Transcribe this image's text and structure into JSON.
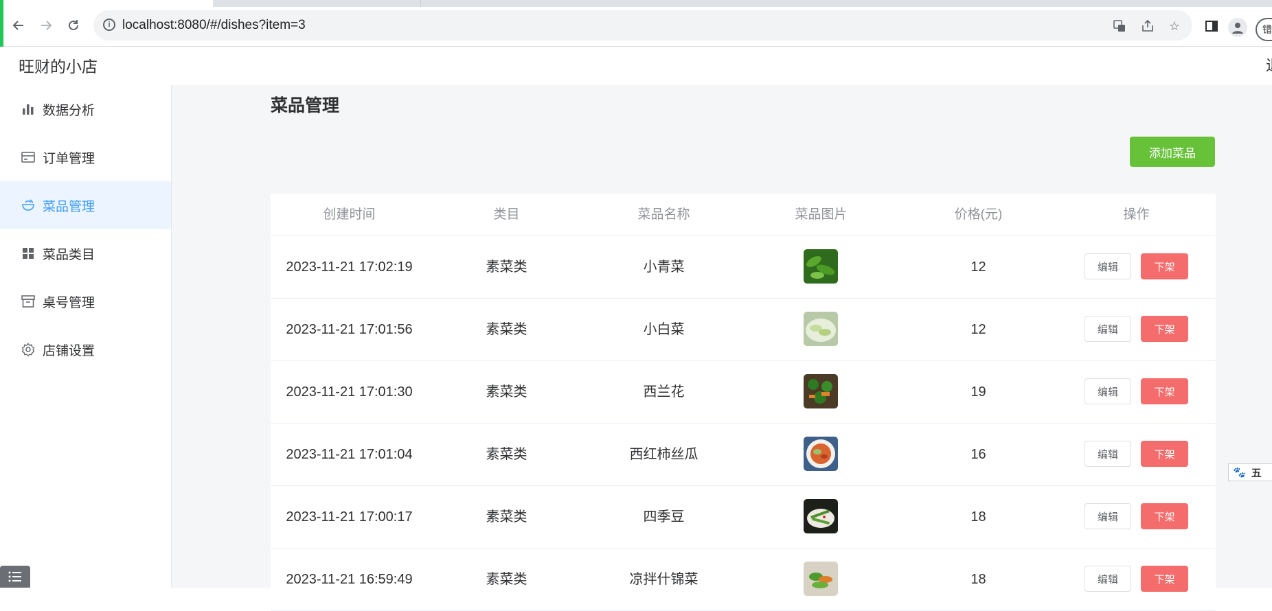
{
  "browser": {
    "url": "localhost:8080/#/dishes?item=3",
    "profile_chip": "错"
  },
  "app": {
    "shop_name": "旺财的小店",
    "header_right": "退"
  },
  "sidebar": {
    "items": [
      {
        "label": "数据分析",
        "icon": "bar-chart-icon"
      },
      {
        "label": "订单管理",
        "icon": "card-icon"
      },
      {
        "label": "菜品管理",
        "icon": "bowl-icon",
        "active": true
      },
      {
        "label": "菜品类目",
        "icon": "grid-icon"
      },
      {
        "label": "桌号管理",
        "icon": "box-icon"
      },
      {
        "label": "店铺设置",
        "icon": "gear-icon"
      }
    ]
  },
  "main": {
    "title": "菜品管理",
    "add_button": "添加菜品",
    "table": {
      "headers": [
        "创建时间",
        "类目",
        "菜品名称",
        "菜品图片",
        "价格(元)",
        "操作"
      ],
      "edit_label": "编辑",
      "off_label": "下架",
      "rows": [
        {
          "time": "2023-11-21 17:02:19",
          "category": "素菜类",
          "name": "小青菜",
          "price": "12",
          "thumb": "greens"
        },
        {
          "time": "2023-11-21 17:01:56",
          "category": "素菜类",
          "name": "小白菜",
          "price": "12",
          "thumb": "cabbage"
        },
        {
          "time": "2023-11-21 17:01:30",
          "category": "素菜类",
          "name": "西兰花",
          "price": "19",
          "thumb": "broccoli"
        },
        {
          "time": "2023-11-21 17:01:04",
          "category": "素菜类",
          "name": "西红柿丝瓜",
          "price": "16",
          "thumb": "tomato"
        },
        {
          "time": "2023-11-21 17:00:17",
          "category": "素菜类",
          "name": "四季豆",
          "price": "18",
          "thumb": "beans"
        },
        {
          "time": "2023-11-21 16:59:49",
          "category": "素菜类",
          "name": "凉拌什锦菜",
          "price": "18",
          "thumb": "salad"
        }
      ]
    }
  },
  "ime": {
    "label": "五"
  }
}
